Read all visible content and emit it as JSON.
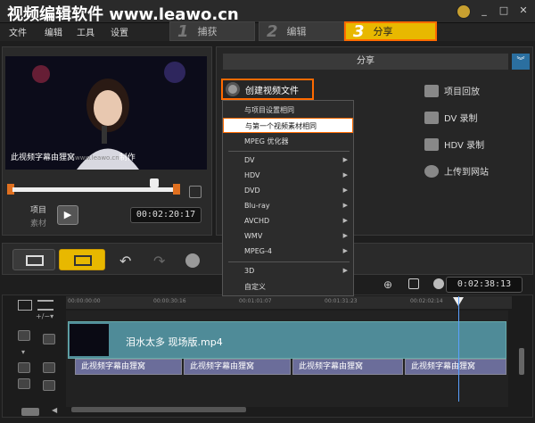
{
  "watermark": "视频编辑软件 www.leawo.cn",
  "window_controls": [
    "_",
    "□",
    "✕"
  ],
  "menu": [
    "文件",
    "编辑",
    "工具",
    "设置"
  ],
  "steps": [
    {
      "num": "1",
      "label": "捕获"
    },
    {
      "num": "2",
      "label": "编辑"
    },
    {
      "num": "3",
      "label": "分享"
    }
  ],
  "preview": {
    "video_caption": "此视频字幕由狸窝",
    "video_caption_tail": "制作",
    "video_watermark": "www.leawo.cn",
    "project_label": "项目",
    "clip_label": "素材",
    "timecode": "00:02:20:17"
  },
  "share": {
    "header": "分享",
    "create_video": "创建视频文件",
    "right_options": [
      "项目回放",
      "DV 录制",
      "HDV 录制",
      "上传到网站"
    ]
  },
  "dropdown": {
    "items": [
      {
        "label": "与项目设置相同",
        "arrow": false
      },
      {
        "label": "与第一个视频素材相同",
        "arrow": false,
        "highlighted": true
      },
      {
        "label": "MPEG 优化器",
        "arrow": false
      },
      {
        "label": "DV",
        "arrow": true
      },
      {
        "label": "HDV",
        "arrow": true
      },
      {
        "label": "DVD",
        "arrow": true
      },
      {
        "label": "Blu-ray",
        "arrow": true
      },
      {
        "label": "AVCHD",
        "arrow": true
      },
      {
        "label": "WMV",
        "arrow": true
      },
      {
        "label": "MPEG-4",
        "arrow": true
      },
      {
        "label": "3D",
        "arrow": true
      },
      {
        "label": "自定义",
        "arrow": false
      }
    ]
  },
  "toolbar": {
    "zoom_timecode": "0:02:38:13"
  },
  "timeline": {
    "ruler_ticks": [
      "00:00:00:00",
      "00:00:30:16",
      "00:01:01:07",
      "00:01:31:23",
      "00:02:02:14"
    ],
    "video_clip": "泪水太多 现场版.mp4",
    "title_clips": [
      "此视频字幕由狸窝",
      "此视频字幕由狸窝",
      "此视频字幕由狸窝",
      "此视频字幕由狸窝"
    ]
  }
}
